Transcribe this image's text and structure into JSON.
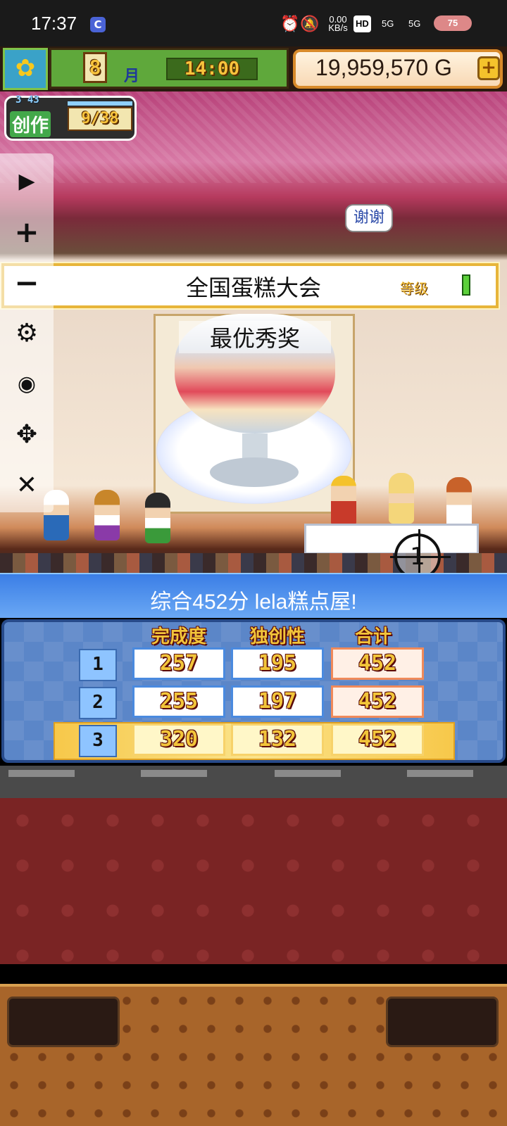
{
  "status_bar": {
    "time": "17:37",
    "net_speed_top": "0.00",
    "net_speed_unit": "KB/s",
    "hd": "HD",
    "signal1": "5G",
    "signal2": "5G",
    "battery": "75"
  },
  "hud": {
    "month": "8",
    "month_label": "月",
    "clock": "14:00",
    "gold": "19,959,570 G",
    "gold_plus": "+"
  },
  "create": {
    "level": "3 43",
    "label": "创作",
    "count": "9/38"
  },
  "sidebar": {
    "play": "▶",
    "plus": "+",
    "minus": "−",
    "settings": "⚙",
    "hide": "◉",
    "move": "✥",
    "close": "✕"
  },
  "speech": "谢谢",
  "contest": {
    "name": "全国蛋糕大会",
    "grade": "等级",
    "award": "最优秀奖"
  },
  "cursor_number": "1",
  "result": {
    "summary": "综合452分 lela糕点屋!"
  },
  "scoreboard": {
    "headers": [
      "完成度",
      "独创性",
      "合计"
    ],
    "rows": [
      {
        "rank": "1",
        "completion": "257",
        "originality": "195",
        "total": "452"
      },
      {
        "rank": "2",
        "completion": "255",
        "originality": "197",
        "total": "452"
      },
      {
        "rank": "3",
        "completion": "320",
        "originality": "132",
        "total": "452"
      }
    ]
  },
  "colors": {
    "banner_blue": "#3b7ee6",
    "gold_text": "#f2c53a",
    "highlight_row": "#f7c84a"
  }
}
